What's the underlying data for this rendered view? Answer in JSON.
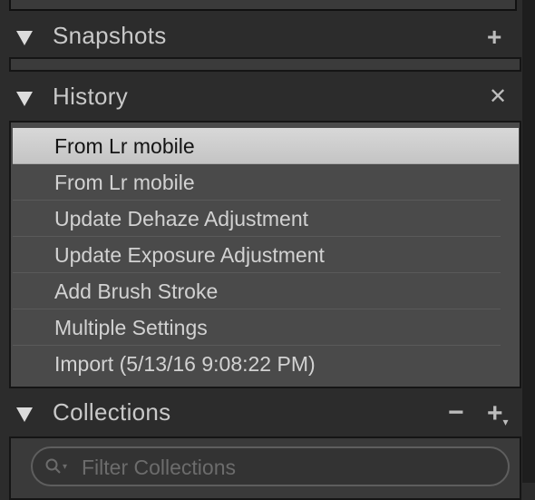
{
  "snapshots": {
    "title": "Snapshots",
    "add_icon": "plus-icon"
  },
  "history": {
    "title": "History",
    "clear_icon": "x-icon",
    "items": [
      "From Lr mobile",
      "From Lr mobile",
      "Update Dehaze Adjustment",
      "Update Exposure Adjustment",
      "Add Brush Stroke",
      "Multiple Settings",
      "Import (5/13/16 9:08:22 PM)"
    ],
    "selected_index": 0
  },
  "collections": {
    "title": "Collections",
    "filter_placeholder": "Filter Collections",
    "remove_icon": "minus-icon",
    "add_icon": "plus-dropdown-icon"
  }
}
